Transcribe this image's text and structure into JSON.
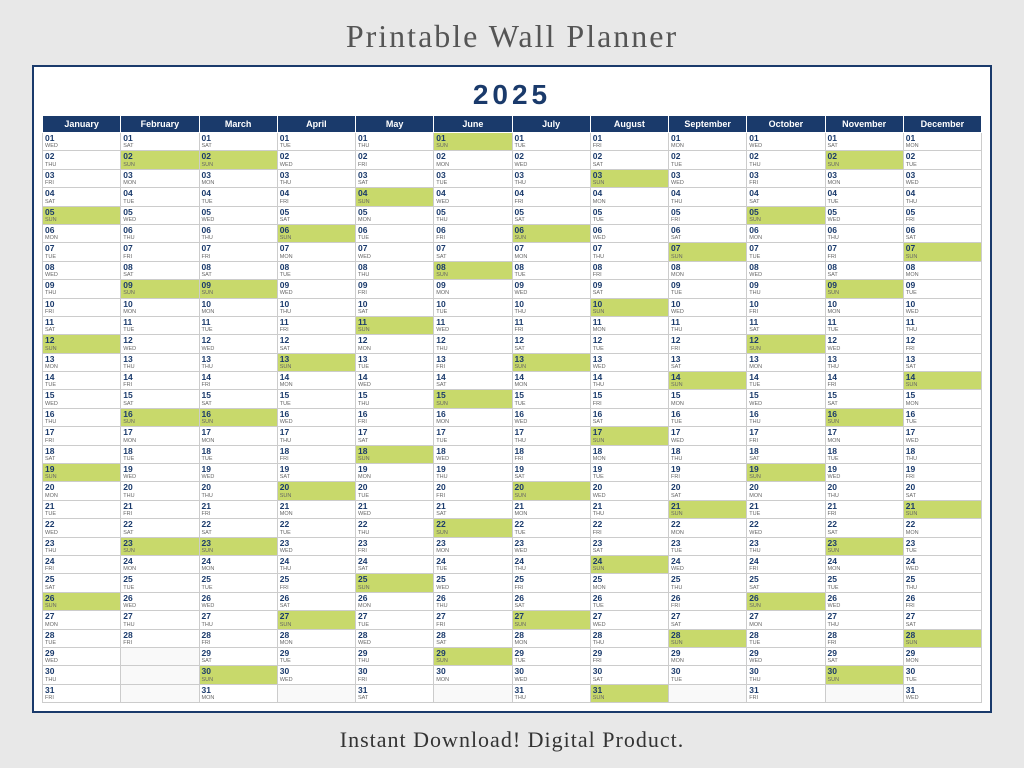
{
  "page": {
    "title": "Printable Wall Planner",
    "bottom_text": "Instant Download!  Digital Product.",
    "year": "2025"
  },
  "months": [
    {
      "label": "January",
      "key": "jan"
    },
    {
      "label": "February",
      "key": "feb"
    },
    {
      "label": "March",
      "key": "mar"
    },
    {
      "label": "April",
      "key": "apr"
    },
    {
      "label": "May",
      "key": "may"
    },
    {
      "label": "June",
      "key": "jun"
    },
    {
      "label": "July",
      "key": "jul"
    },
    {
      "label": "August",
      "key": "aug"
    },
    {
      "label": "September",
      "key": "sep"
    },
    {
      "label": "October",
      "key": "oct"
    },
    {
      "label": "November",
      "key": "nov"
    },
    {
      "label": "December",
      "key": "dec"
    }
  ],
  "calendar": {
    "days": [
      {
        "d": "01",
        "jan": "WED",
        "feb": "SAT",
        "mar": "SAT",
        "apr": "TUE",
        "may": "THU",
        "jun": "SUN",
        "jul": "TUE",
        "aug": "FRI",
        "sep": "MON",
        "oct": "WED",
        "nov": "SAT",
        "dec": "MON"
      },
      {
        "d": "02",
        "jan": "THU",
        "feb": "SUN",
        "mar": "SUN",
        "apr": "WED",
        "may": "FRI",
        "jun": "MON",
        "jul": "WED",
        "aug": "SAT",
        "sep": "TUE",
        "oct": "THU",
        "nov": "SUN",
        "dec": "TUE"
      },
      {
        "d": "03",
        "jan": "FRI",
        "feb": "MON",
        "mar": "MON",
        "apr": "THU",
        "may": "SAT",
        "jun": "TUE",
        "jul": "THU",
        "aug": "SUN",
        "sep": "WED",
        "oct": "FRI",
        "nov": "MON",
        "dec": "WED"
      },
      {
        "d": "04",
        "jan": "SAT",
        "feb": "TUE",
        "mar": "TUE",
        "apr": "FRI",
        "may": "SUN",
        "jun": "WED",
        "jul": "FRI",
        "aug": "MON",
        "sep": "THU",
        "oct": "SAT",
        "nov": "TUE",
        "dec": "THU"
      },
      {
        "d": "05",
        "jan": "SUN",
        "feb": "WED",
        "mar": "WED",
        "apr": "SAT",
        "may": "MON",
        "jun": "THU",
        "jul": "SAT",
        "aug": "TUE",
        "sep": "FRI",
        "oct": "SUN",
        "nov": "WED",
        "dec": "FRI"
      },
      {
        "d": "06",
        "jan": "MON",
        "feb": "THU",
        "mar": "THU",
        "apr": "SUN",
        "may": "TUE",
        "jun": "FRI",
        "jul": "SUN",
        "aug": "WED",
        "sep": "SAT",
        "oct": "MON",
        "nov": "THU",
        "dec": "SAT"
      },
      {
        "d": "07",
        "jan": "TUE",
        "feb": "FRI",
        "mar": "FRI",
        "apr": "MON",
        "may": "WED",
        "jun": "SAT",
        "jul": "MON",
        "aug": "THU",
        "sep": "SUN",
        "oct": "TUE",
        "nov": "FRI",
        "dec": "SUN"
      },
      {
        "d": "08",
        "jan": "WED",
        "feb": "SAT",
        "mar": "SAT",
        "apr": "TUE",
        "may": "THU",
        "jun": "SUN",
        "jul": "TUE",
        "aug": "FRI",
        "sep": "MON",
        "oct": "WED",
        "nov": "SAT",
        "dec": "MON"
      },
      {
        "d": "09",
        "jan": "THU",
        "feb": "SUN",
        "mar": "SUN",
        "apr": "WED",
        "may": "FRI",
        "jun": "MON",
        "jul": "WED",
        "aug": "SAT",
        "sep": "TUE",
        "oct": "THU",
        "nov": "SUN",
        "dec": "TUE"
      },
      {
        "d": "10",
        "jan": "FRI",
        "feb": "MON",
        "mar": "MON",
        "apr": "THU",
        "may": "SAT",
        "jun": "TUE",
        "jul": "THU",
        "aug": "SUN",
        "sep": "WED",
        "oct": "FRI",
        "nov": "MON",
        "dec": "WED"
      },
      {
        "d": "11",
        "jan": "SAT",
        "feb": "TUE",
        "mar": "TUE",
        "apr": "FRI",
        "may": "SUN",
        "jun": "WED",
        "jul": "FRI",
        "aug": "MON",
        "sep": "THU",
        "oct": "SAT",
        "nov": "TUE",
        "dec": "THU"
      },
      {
        "d": "12",
        "jan": "SUN",
        "feb": "WED",
        "mar": "WED",
        "apr": "SAT",
        "may": "MON",
        "jun": "THU",
        "jul": "SAT",
        "aug": "TUE",
        "sep": "FRI",
        "oct": "SUN",
        "nov": "WED",
        "dec": "FRI"
      },
      {
        "d": "13",
        "jan": "MON",
        "feb": "THU",
        "mar": "THU",
        "apr": "SUN",
        "may": "TUE",
        "jun": "FRI",
        "jul": "SUN",
        "aug": "WED",
        "sep": "SAT",
        "oct": "MON",
        "nov": "THU",
        "dec": "SAT"
      },
      {
        "d": "14",
        "jan": "TUE",
        "feb": "FRI",
        "mar": "FRI",
        "apr": "MON",
        "may": "WED",
        "jun": "SAT",
        "jul": "MON",
        "aug": "THU",
        "sep": "SUN",
        "oct": "TUE",
        "nov": "FRI",
        "dec": "SUN"
      },
      {
        "d": "15",
        "jan": "WED",
        "feb": "SAT",
        "mar": "SAT",
        "apr": "TUE",
        "may": "THU",
        "jun": "SUN",
        "jul": "TUE",
        "aug": "FRI",
        "sep": "MON",
        "oct": "WED",
        "nov": "SAT",
        "dec": "MON"
      },
      {
        "d": "16",
        "jan": "THU",
        "feb": "SUN",
        "mar": "SUN",
        "apr": "WED",
        "may": "FRI",
        "jun": "MON",
        "jul": "WED",
        "aug": "SAT",
        "sep": "TUE",
        "oct": "THU",
        "nov": "SUN",
        "dec": "TUE"
      },
      {
        "d": "17",
        "jan": "FRI",
        "feb": "MON",
        "mar": "MON",
        "apr": "THU",
        "may": "SAT",
        "jun": "TUE",
        "jul": "THU",
        "aug": "SUN",
        "sep": "WED",
        "oct": "FRI",
        "nov": "MON",
        "dec": "WED"
      },
      {
        "d": "18",
        "jan": "SAT",
        "feb": "TUE",
        "mar": "TUE",
        "apr": "FRI",
        "may": "SUN",
        "jun": "WED",
        "jul": "FRI",
        "aug": "MON",
        "sep": "THU",
        "oct": "SAT",
        "nov": "TUE",
        "dec": "THU"
      },
      {
        "d": "19",
        "jan": "SUN",
        "feb": "WED",
        "mar": "WED",
        "apr": "SAT",
        "may": "MON",
        "jun": "THU",
        "jul": "SAT",
        "aug": "TUE",
        "sep": "FRI",
        "oct": "SUN",
        "nov": "WED",
        "dec": "FRI"
      },
      {
        "d": "20",
        "jan": "MON",
        "feb": "THU",
        "mar": "THU",
        "apr": "SUN",
        "may": "TUE",
        "jun": "FRI",
        "jul": "SUN",
        "aug": "WED",
        "sep": "SAT",
        "oct": "MON",
        "nov": "THU",
        "dec": "SAT"
      },
      {
        "d": "21",
        "jan": "TUE",
        "feb": "FRI",
        "mar": "FRI",
        "apr": "MON",
        "may": "WED",
        "jun": "SAT",
        "jul": "MON",
        "aug": "THU",
        "sep": "SUN",
        "oct": "TUE",
        "nov": "FRI",
        "dec": "SUN"
      },
      {
        "d": "22",
        "jan": "WED",
        "feb": "SAT",
        "mar": "SAT",
        "apr": "TUE",
        "may": "THU",
        "jun": "SUN",
        "jul": "TUE",
        "aug": "FRI",
        "sep": "MON",
        "oct": "WED",
        "nov": "SAT",
        "dec": "MON"
      },
      {
        "d": "23",
        "jan": "THU",
        "feb": "SUN",
        "mar": "SUN",
        "apr": "WED",
        "may": "FRI",
        "jun": "MON",
        "jul": "WED",
        "aug": "SAT",
        "sep": "TUE",
        "oct": "THU",
        "nov": "SUN",
        "dec": "TUE"
      },
      {
        "d": "24",
        "jan": "FRI",
        "feb": "MON",
        "mar": "MON",
        "apr": "THU",
        "may": "SAT",
        "jun": "TUE",
        "jul": "THU",
        "aug": "SUN",
        "sep": "WED",
        "oct": "FRI",
        "nov": "MON",
        "dec": "WED"
      },
      {
        "d": "25",
        "jan": "SAT",
        "feb": "TUE",
        "mar": "TUE",
        "apr": "FRI",
        "may": "SUN",
        "jun": "WED",
        "jul": "FRI",
        "aug": "MON",
        "sep": "THU",
        "oct": "SAT",
        "nov": "TUE",
        "dec": "THU"
      },
      {
        "d": "26",
        "jan": "SUN",
        "feb": "WED",
        "mar": "WED",
        "apr": "SAT",
        "may": "MON",
        "jun": "THU",
        "jul": "SAT",
        "aug": "TUE",
        "sep": "FRI",
        "oct": "SUN",
        "nov": "WED",
        "dec": "FRI"
      },
      {
        "d": "27",
        "jan": "MON",
        "feb": "THU",
        "mar": "THU",
        "apr": "SUN",
        "may": "TUE",
        "jun": "FRI",
        "jul": "SUN",
        "aug": "WED",
        "sep": "SAT",
        "oct": "MON",
        "nov": "THU",
        "dec": "SAT"
      },
      {
        "d": "28",
        "jan": "TUE",
        "feb": "FRI",
        "mar": "FRI",
        "apr": "MON",
        "may": "WED",
        "jun": "SAT",
        "jul": "MON",
        "aug": "THU",
        "sep": "SUN",
        "oct": "TUE",
        "nov": "FRI",
        "dec": "SUN"
      },
      {
        "d": "29",
        "jan": "WED",
        "feb": null,
        "mar": "SAT",
        "apr": "TUE",
        "may": "THU",
        "jun": "SUN",
        "jul": "TUE",
        "aug": "FRI",
        "sep": "MON",
        "oct": "WED",
        "nov": "SAT",
        "dec": "MON"
      },
      {
        "d": "30",
        "jan": "THU",
        "feb": null,
        "mar": "SUN",
        "apr": "WED",
        "may": "FRI",
        "jun": "MON",
        "jul": "WED",
        "aug": "SAT",
        "sep": "TUE",
        "oct": "THU",
        "nov": "SUN",
        "dec": "TUE"
      },
      {
        "d": "31",
        "jan": "FRI",
        "feb": null,
        "mar": "MON",
        "apr": null,
        "may": "SAT",
        "jun": null,
        "jul": "THU",
        "aug": "SUN",
        "sep": null,
        "oct": "FRI",
        "nov": null,
        "dec": "WED"
      }
    ]
  }
}
